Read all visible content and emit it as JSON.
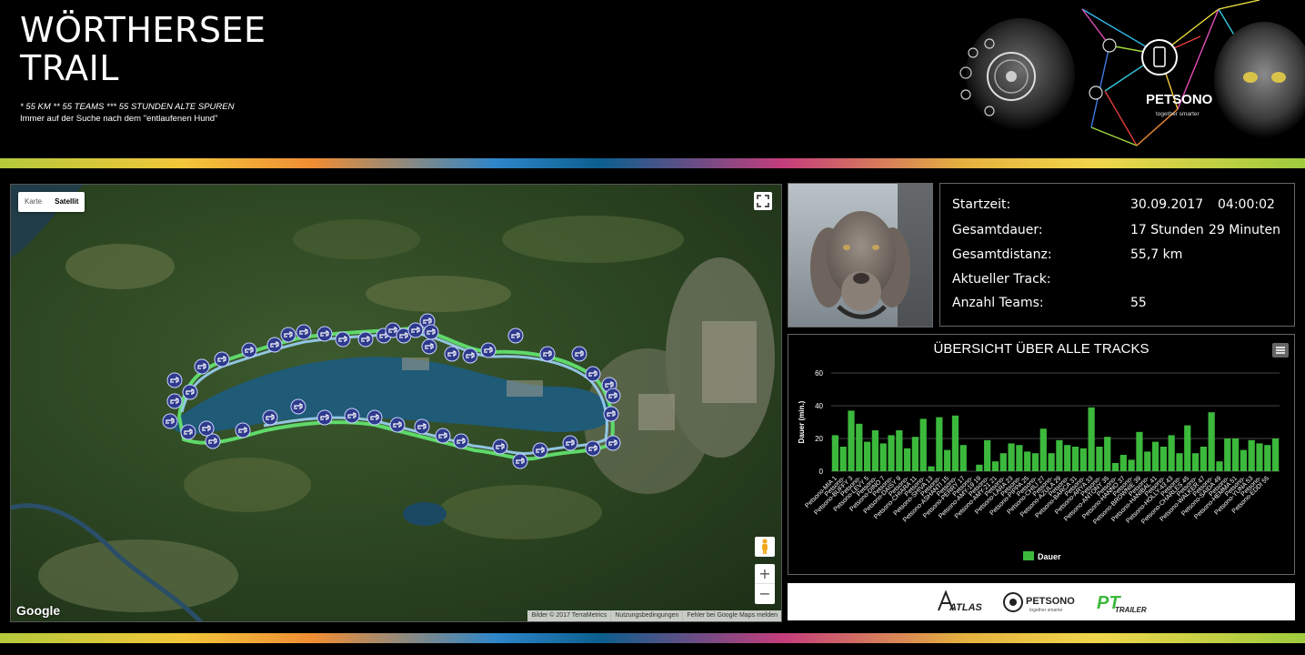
{
  "header": {
    "title": "WÖRTHERSEE TRAIL",
    "tagline": "* 55 KM ** 55 TEAMS *** 55 STUNDEN ALTE SPUREN",
    "subtitle": "Immer auf der Suche nach dem \"entlaufenen Hund\"",
    "brand_name": "PETSONO",
    "brand_slogan": "together smarter"
  },
  "map": {
    "type_options": [
      "Karte",
      "Satellit"
    ],
    "active_type": "Satellit",
    "google_label": "Google",
    "footer": [
      "Bilder © 2017 TerraMetrics",
      "Nutzungsbedingungen",
      "Fehler bei Google Maps melden"
    ],
    "zoom_in": "+",
    "zoom_out": "−",
    "icons": {
      "fullscreen": "fullscreen-icon",
      "pegman": "pegman-icon",
      "marker": "dog-marker-icon"
    }
  },
  "info": {
    "rows": [
      {
        "label": "Startzeit:",
        "value": "30.09.2017",
        "value2": "04:00:02"
      },
      {
        "label": "Gesamtdauer:",
        "value": "17 Stunden",
        "value2": "29 Minuten"
      },
      {
        "label": "Gesamtdistanz:",
        "value": "55,7 km",
        "value2": ""
      },
      {
        "label": "Aktueller Track:",
        "value": "",
        "value2": ""
      },
      {
        "label": "Anzahl Teams:",
        "value": "55",
        "value2": ""
      }
    ]
  },
  "chart_data": {
    "type": "bar",
    "title": "ÜBERSICHT ÜBER ALLE TRACKS",
    "xlabel": "",
    "ylabel": "Dauer (min.)",
    "ylim": [
      0,
      60
    ],
    "yticks": [
      0,
      20,
      40,
      60
    ],
    "grid": true,
    "legend_position": "bottom",
    "bar_color": "#3cb93c",
    "categories": [
      "Petsono-MIA 1",
      "Petsono-",
      "Petsono-BUFFY 3",
      "Petsono-",
      "Petsono-LEVY 5",
      "Petsono-",
      "Petsono-DINO 7",
      "Petsono-",
      "Petsono-DAISY 9",
      "Petsono-",
      "Petsono-CHIARA 11",
      "Petsono-",
      "Petsono-SHIVA 13",
      "Petsono-",
      "Petsono-ASHANTI 15",
      "Petsono-",
      "Petsono-PERRY 17",
      "Petsono-",
      "Petsono-AMY-19 19",
      "Petsono-",
      "Petsono-AMY-21 21",
      "Petsono-",
      "Petsono-LARA 23",
      "Petsono-",
      "Petsono-PIPPA 25",
      "Petsono-",
      "Petsono-CHILI 27",
      "Petsono-",
      "Petsono-AZULA 29",
      "Petsono-",
      "Petsono-BARCA 31",
      "Petsono-",
      "Petsono-ARYA 33",
      "Petsono-",
      "Petsono-ANTONY 35",
      "Petsono-",
      "Petsono-HANNO 37",
      "Petsono-",
      "Petsono-BROWNIE 39",
      "Petsono-",
      "Petsono-HANIBAL 41",
      "Petsono-",
      "Petsono-HOLLY-43 43",
      "Petsono-",
      "Petsono-CHARLES 45",
      "Petsono-",
      "Petsono-WALKER 47",
      "Petsono-",
      "Petsono-SAIDA 49",
      "Petsono-",
      "Petsono-HEMMA 51",
      "Petsono-",
      "Petsono-YUNA 53",
      "Petsono-",
      "Petsono-EDDI 55"
    ],
    "series": [
      {
        "name": "Dauer",
        "values": [
          22,
          15,
          37,
          29,
          18,
          25,
          17,
          22,
          25,
          14,
          21,
          32,
          3,
          33,
          13,
          34,
          16,
          0,
          4,
          19,
          6,
          11,
          17,
          16,
          12,
          11,
          26,
          11,
          19,
          16,
          15,
          14,
          39,
          15,
          21,
          5,
          10,
          7,
          24,
          12,
          18,
          15,
          22,
          11,
          28,
          11,
          15,
          36,
          6,
          20,
          20,
          13,
          19,
          17,
          16,
          20
        ]
      }
    ]
  }
}
